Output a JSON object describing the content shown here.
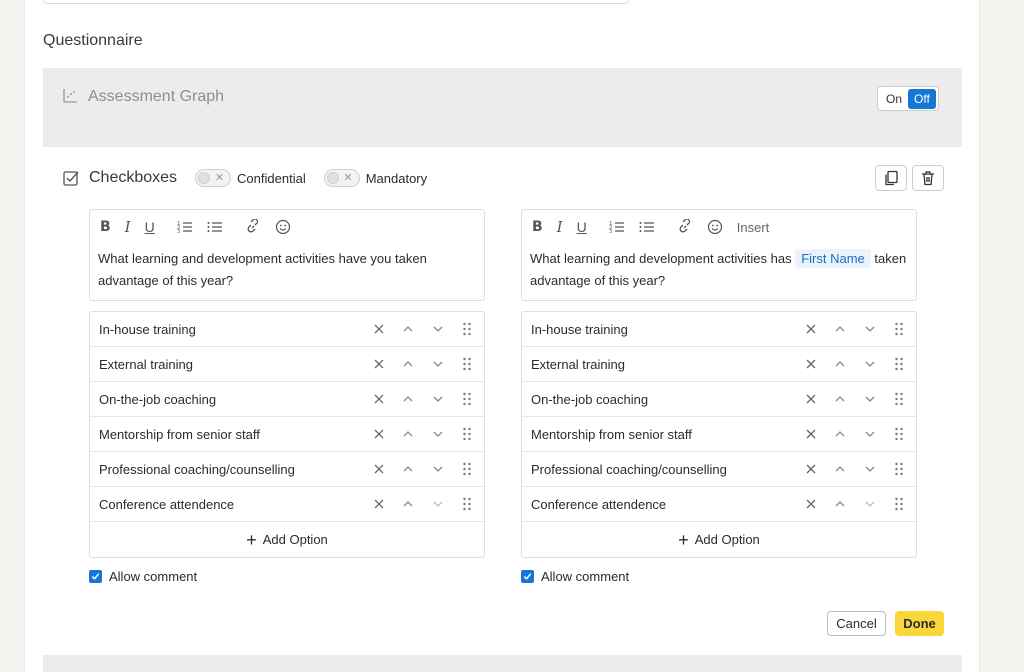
{
  "section_title": "Questionnaire",
  "assessment": {
    "label": "Assessment Graph",
    "toggle_on": "On",
    "toggle_off": "Off"
  },
  "checkboxes": {
    "title": "Checkboxes",
    "confidential_label": "Confidential",
    "mandatory_label": "Mandatory"
  },
  "left": {
    "question": "What learning and development activities have you taken advantage of this year?",
    "options": [
      "In-house training",
      "External training",
      "On-the-job coaching",
      "Mentorship from senior staff",
      "Professional coaching/counselling",
      "Conference attendence"
    ],
    "add_option": "Add Option",
    "allow_comment": "Allow comment"
  },
  "right": {
    "insert_label": "Insert",
    "question_before": "What learning and development activities has",
    "chip": "First Name",
    "question_after": "taken advantage of this year?",
    "options": [
      "In-house training",
      "External training",
      "On-the-job coaching",
      "Mentorship from senior staff",
      "Professional coaching/counselling",
      "Conference attendence"
    ],
    "add_option": "Add Option",
    "allow_comment": "Allow comment"
  },
  "actions": {
    "cancel": "Cancel",
    "done": "Done"
  },
  "colors": {
    "accent": "#1576d4",
    "done_button": "#fbd63a",
    "chip_bg": "#eaf3fb"
  }
}
